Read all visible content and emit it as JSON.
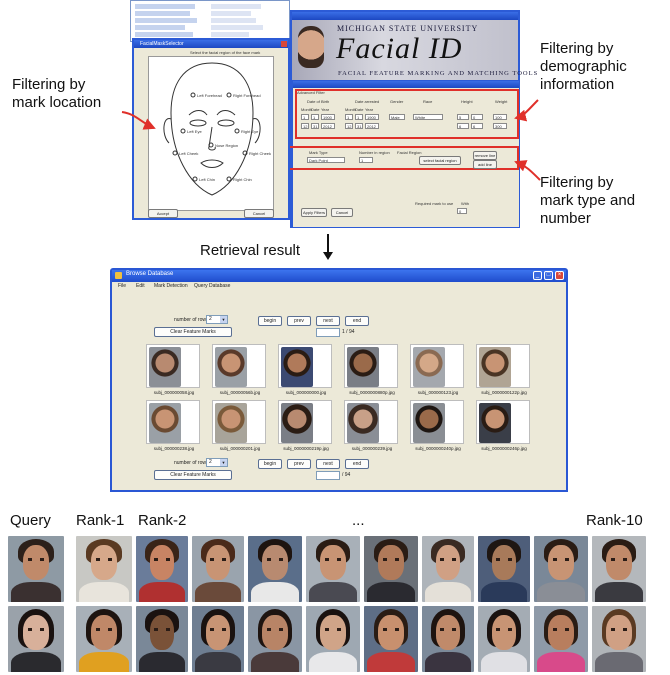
{
  "callouts": {
    "mark_location": "Filtering by\nmark location",
    "demographic": "Filtering by\ndemographic\ninformation",
    "mark_type": "Filtering by\nmark type and\nnumber",
    "retrieval": "Retrieval result"
  },
  "facialid": {
    "university": "MICHIGAN STATE UNIVERSITY",
    "title": "Facial ID",
    "subtitle": "FACIAL FEATURE MARKING AND MATCHING TOOLS"
  },
  "mask_window": {
    "title": "FacialMaskSelector",
    "instruction": "Select the facial region of the face mark",
    "regions": [
      "Left Forehead",
      "Right Forehead",
      "Left Eye",
      "Right Eye",
      "Nose Region",
      "Left Cheek",
      "Right Cheek",
      "Left Chin",
      "Right Chin"
    ],
    "accept_label": "Accept",
    "cancel_label": "Cancel"
  },
  "filter_window": {
    "group_label": "Advanced Filter",
    "columns": [
      "Date of Birth",
      "Date arrested",
      "Gender",
      "Race",
      "Height",
      "Weight"
    ],
    "subcols": [
      "Month",
      "Date",
      "Year"
    ],
    "row1": [
      "1",
      "1",
      "1900",
      "1",
      "1",
      "1900",
      "Male",
      "White",
      "5",
      "0",
      "100"
    ],
    "row2": [
      "12",
      "31",
      "2012",
      "12",
      "31",
      "2012",
      "",
      "",
      "6",
      "6",
      "300"
    ],
    "mark_type_label": "Mark Type",
    "mark_type_value": "Dark Point",
    "number_label": "Number in region",
    "number_value": "1",
    "facial_region_label": "Facial Region",
    "select_region_btn": "select facial region",
    "remove_btn": "remove line",
    "add_btn": "add line",
    "apply_btn": "Apply Filters",
    "cancel_btn": "Cancel",
    "required_label": "Required mark to use",
    "with_label": "With",
    "count_value": "0"
  },
  "browser": {
    "title": "Browse Database",
    "menu": [
      "File",
      "Edit",
      "Mark Detection",
      "Query Database"
    ],
    "num_rows_label": "number of rows:",
    "num_rows_value": "2",
    "nav": [
      "begin",
      "prev",
      "next",
      "end"
    ],
    "clear_btn": "Clear Feature Marks",
    "page_total": "1 / 94",
    "captions_row1": [
      "subj_000000058.jpg",
      "subj_00000056b.jpg",
      "subj_000000000.jpg",
      "subj_0000000880p.jpg",
      "subj_000000123.jpg",
      "subj_0000000122p.jpg"
    ],
    "captions_row2": [
      "subj_000000238.jpg",
      "subj_000000201.jpg",
      "subj_0000000219p.jpg",
      "subj_000000239.jpg",
      "subj_0000000240p.jpg",
      "subj_0000000246p.jpg"
    ],
    "bottom_total": "/ 94"
  },
  "gallery": {
    "query_label": "Query",
    "rank1_label": "Rank-1",
    "rank2_label": "Rank-2",
    "ellipsis": "...",
    "rank10_label": "Rank-10"
  },
  "colors": {
    "annotation_red": "#e0302a",
    "xp_title_blue": "#2a57d4",
    "window_face": "#ece9d8"
  }
}
